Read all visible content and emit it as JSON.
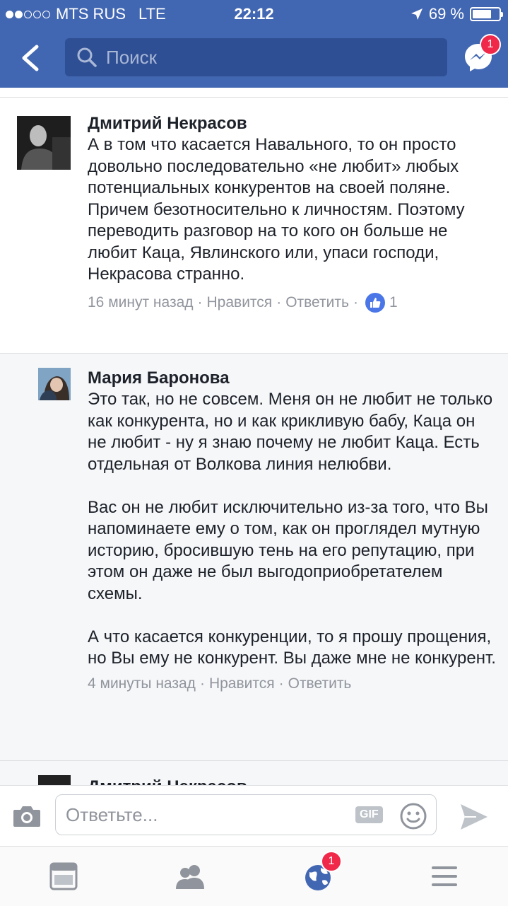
{
  "status_bar": {
    "carrier": "MTS RUS",
    "network": "LTE",
    "time": "22:12",
    "battery": "69 %",
    "signal_bars": 2
  },
  "nav": {
    "search_placeholder": "Поиск",
    "messenger_badge": "1"
  },
  "comments": [
    {
      "author": "Дмитрий Некрасов",
      "paragraphs": [
        "А в том что касается Навального, то он просто довольно последовательно «не любит» любых потенциальных конкурентов на своей поляне. Причем безотносительно к личностям. Поэтому переводить разговор на то кого он больше не любит Каца, Явлинского или, упаси господи, Некрасова странно."
      ],
      "time": "16 минут назад",
      "like_label": "Нравится",
      "reply_label": "Ответить",
      "likes": "1"
    },
    {
      "author": "Мария Баронова",
      "paragraphs": [
        "Это так, но не совсем. Меня он не любит не только как конкурента, но и как крикливую бабу, Каца он не любит - ну я знаю почему не любит Каца. Есть отдельная от Волкова линия нелюбви.",
        "Вас он не любит исключительно из-за того, что Вы напоминаете ему о том, как он проглядел мутную историю, бросившую тень на его репутацию, при этом он даже не был выгодоприобретателем схемы.",
        "А что касается конкуренции, то я прошу прощения, но Вы ему не конкурент. Вы даже мне не конкурент."
      ],
      "time": "4 минуты назад",
      "like_label": "Нравится",
      "reply_label": "Ответить"
    },
    {
      "author": "Дмитрий Некрасов"
    }
  ],
  "composer": {
    "placeholder": "Ответьте...",
    "gif_label": "GIF"
  },
  "tabbar": {
    "notifications_badge": "1"
  },
  "colors": {
    "brand": "#4267b2",
    "search_bg": "#2f4f94",
    "badge": "#f02849",
    "meta_text": "#90949c",
    "reply_thread_bg": "#f6f7f9"
  }
}
